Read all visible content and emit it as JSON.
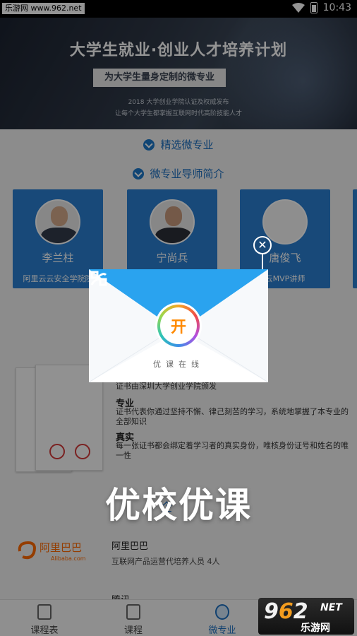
{
  "status_bar": {
    "watermark": "乐游网 www.962.net",
    "time": "10:43"
  },
  "banner": {
    "title": "大学生就业·创业人才培养计划",
    "pill": "为大学生量身定制的微专业",
    "sub_line_1": "2018 大学创业学院认证及权威发布",
    "sub_line_2": "让每个大学生都掌握互联网时代高阶技能人才"
  },
  "sections": {
    "featured": "精选微专业",
    "mentors": "微专业导师简介"
  },
  "teachers": [
    {
      "name": "李兰柱",
      "desc": "阿里云云安全学院院"
    },
    {
      "name": "宁尚兵",
      "desc": ""
    },
    {
      "name": "唐俊飞",
      "desc": "云MVP讲师"
    }
  ],
  "certificate": {
    "issued_by": "证书由深圳大学创业学院颁发",
    "major_title": "专业",
    "major_text_1": "证书代表你通过坚持不懈、律己刻苦的学习，系统地掌握了本专业的",
    "major_text_2": "全部知识",
    "real_title": "真实",
    "real_text_1": "每一张证书都会绑定着学习者的真实身份，唯核身份证号和姓名的唯",
    "real_text_2": "一性"
  },
  "promo": {
    "title": "优校优课",
    "behind": "企"
  },
  "partners": [
    {
      "logo_text": "阿里巴巴",
      "logo_sub": "Alibaba.com",
      "name": "阿里巴巴",
      "desc": "互联网产品运营代培养人员 4人"
    },
    {
      "name": "腾讯"
    }
  ],
  "tabs": [
    {
      "label": "课程表",
      "icon": "calendar-icon"
    },
    {
      "label": "课程",
      "icon": "book-icon"
    },
    {
      "label": "微专业",
      "icon": "major-icon"
    },
    {
      "label": "",
      "icon": "user-icon"
    }
  ],
  "badge": {
    "num_prefix": "9",
    "num_mid": "6",
    "num_suffix": "2",
    "net": "NET",
    "label": "乐游网"
  },
  "dialog": {
    "button_label": "开",
    "tagline": "优课在线"
  },
  "colors": {
    "primary": "#1c6fbf",
    "card_blue": "#2a7fd0",
    "dialog_blue": "#2aa3ef",
    "open_orange": "#ff8a00"
  }
}
